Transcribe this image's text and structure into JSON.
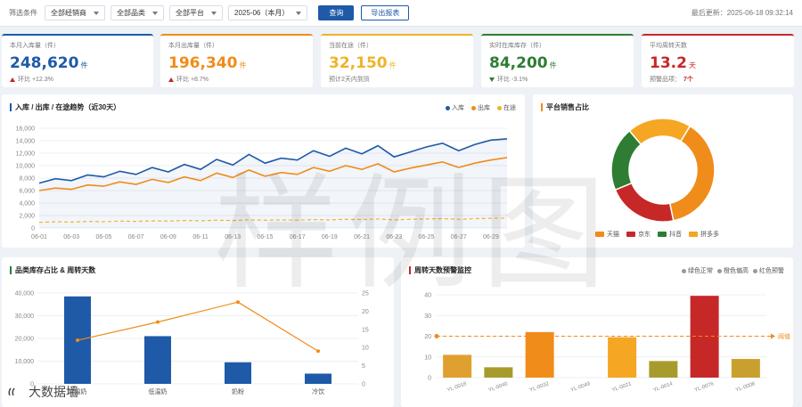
{
  "filters": {
    "label": "筛选条件",
    "dealer": "全部经销商",
    "category": "全部品类",
    "platform": "全部平台",
    "month": "2025-06（本月）",
    "query_btn": "查询",
    "export_btn": "导出报表",
    "updated": "最后更新：2025-06-18 09:32:14"
  },
  "kpis": [
    {
      "title": "本月入库量（件）",
      "value": "248,620",
      "unit": "件",
      "sub": "环比 +12.3%",
      "color": "#1e5aa8",
      "trend": "up"
    },
    {
      "title": "本月出库量（件）",
      "value": "196,340",
      "unit": "件",
      "sub": "环比 +8.7%",
      "color": "#f08c1a",
      "trend": "up"
    },
    {
      "title": "当前在途（件）",
      "value": "32,150",
      "unit": "件",
      "sub": "预计2天内到货",
      "color": "#f0b429",
      "trend": "none"
    },
    {
      "title": "实时在库库存（件）",
      "value": "84,200",
      "unit": "件",
      "sub": "环比 -3.1%",
      "color": "#2e7d32",
      "trend": "down"
    },
    {
      "title": "平均周转天数",
      "value": "13.2",
      "unit": "天",
      "sub_label": "预警品项：",
      "sub_value": "7个",
      "color": "#c62828",
      "trend": "none"
    }
  ],
  "trend_panel": {
    "title": "入库 / 出库 / 在途趋势（近30天）",
    "legend": [
      "入库",
      "出库",
      "在途"
    ]
  },
  "pie_panel": {
    "title": "平台销售占比",
    "legend": [
      "天猫",
      "京东",
      "抖音",
      "拼多多"
    ]
  },
  "bar_panel": {
    "title": "品类库存占比 & 周转天数"
  },
  "warn_panel": {
    "title": "周转天数预警监控",
    "legend": [
      "绿色正常",
      "橙色偏高",
      "红色预警"
    ],
    "threshold_label": "阈值"
  },
  "watermark": "样例图",
  "brand": "大数据墙",
  "chart_data": [
    {
      "type": "line",
      "title": "入库 / 出库 / 在途趋势（近30天）",
      "x": [
        "06-01",
        "06-02",
        "06-03",
        "06-04",
        "06-05",
        "06-06",
        "06-07",
        "06-08",
        "06-09",
        "06-10",
        "06-11",
        "06-12",
        "06-13",
        "06-14",
        "06-15",
        "06-16",
        "06-17",
        "06-18",
        "06-19",
        "06-20",
        "06-21",
        "06-22",
        "06-23",
        "06-24",
        "06-25",
        "06-26",
        "06-27",
        "06-28",
        "06-29",
        "06-30"
      ],
      "xticks": [
        "06-01",
        "06-03",
        "06-05",
        "06-07",
        "06-09",
        "06-11",
        "06-13",
        "06-15",
        "06-17",
        "06-19",
        "06-21",
        "06-23",
        "06-25",
        "06-27",
        "06-29"
      ],
      "ylim": [
        0,
        16000
      ],
      "yticks": [
        "0",
        "2,000",
        "4,000",
        "6,000",
        "8,000",
        "10,000",
        "12,000",
        "14,000",
        "16,000"
      ],
      "series": [
        {
          "name": "入库",
          "color": "#1e5aa8",
          "values": [
            7200,
            7900,
            7600,
            8500,
            8200,
            9100,
            8600,
            9700,
            9000,
            10200,
            9400,
            11000,
            10100,
            11800,
            10400,
            11200,
            10900,
            12400,
            11500,
            12800,
            11900,
            13200,
            11400,
            12200,
            13000,
            13600,
            12400,
            13400,
            14100,
            14300
          ]
        },
        {
          "name": "出库",
          "color": "#f08c1a",
          "values": [
            6000,
            6400,
            6200,
            6900,
            6700,
            7400,
            7000,
            7800,
            7300,
            8200,
            7600,
            8800,
            8100,
            9300,
            8300,
            8900,
            8600,
            9700,
            9100,
            10000,
            9400,
            10300,
            9000,
            9600,
            10100,
            10600,
            9700,
            10400,
            10900,
            11300
          ]
        },
        {
          "name": "在途",
          "color": "#f0b429",
          "values": [
            900,
            1000,
            950,
            1050,
            1000,
            1100,
            1050,
            1150,
            1100,
            1200,
            1150,
            1250,
            1200,
            1300,
            1250,
            1300,
            1250,
            1350,
            1300,
            1400,
            1350,
            1450,
            1300,
            1400,
            1450,
            1500,
            1400,
            1500,
            1550,
            1600
          ]
        }
      ]
    },
    {
      "type": "pie",
      "title": "平台销售占比",
      "labels": [
        "天猫",
        "京东",
        "抖音",
        "拼多多"
      ],
      "values": [
        38,
        22,
        20,
        20
      ],
      "colors": [
        "#f08c1a",
        "#c62828",
        "#2e7d32",
        "#f5a623"
      ]
    },
    {
      "type": "bar",
      "title": "品类库存占比 & 周转天数",
      "categories": [
        "常温奶",
        "低温奶",
        "奶粉",
        "冷饮"
      ],
      "series": [
        {
          "name": "库存",
          "type": "bar",
          "color": "#1e5aa8",
          "values": [
            38500,
            21000,
            9500,
            4500
          ]
        },
        {
          "name": "周转天数",
          "type": "line",
          "color": "#f08c1a",
          "values": [
            12,
            17,
            22.5,
            9
          ]
        }
      ],
      "ylim": [
        0,
        40000
      ],
      "yticks": [
        "0",
        "10,000",
        "20,000",
        "30,000",
        "40,000"
      ],
      "y2lim": [
        0,
        25
      ],
      "y2ticks": [
        "0",
        "5",
        "10",
        "15",
        "20",
        "25"
      ]
    },
    {
      "type": "bar",
      "title": "周转天数预警监控",
      "categories": [
        "YL-0018",
        "YL-0040",
        "YL-0032",
        "YL-0049",
        "YL-0021",
        "YL-0014",
        "YL-0076",
        "YL-0008"
      ],
      "values": [
        11,
        5,
        22,
        0,
        19.5,
        8,
        39.5,
        9
      ],
      "colors": [
        "#e0a030",
        "#a89b2e",
        "#f08c1a",
        "#e0a030",
        "#f5a623",
        "#a89b2e",
        "#c62828",
        "#c9a02e"
      ],
      "threshold": 20,
      "threshold_label": "阈值",
      "ylim": [
        0,
        40
      ],
      "yticks": [
        "0",
        "10",
        "20",
        "30",
        "40"
      ]
    }
  ]
}
